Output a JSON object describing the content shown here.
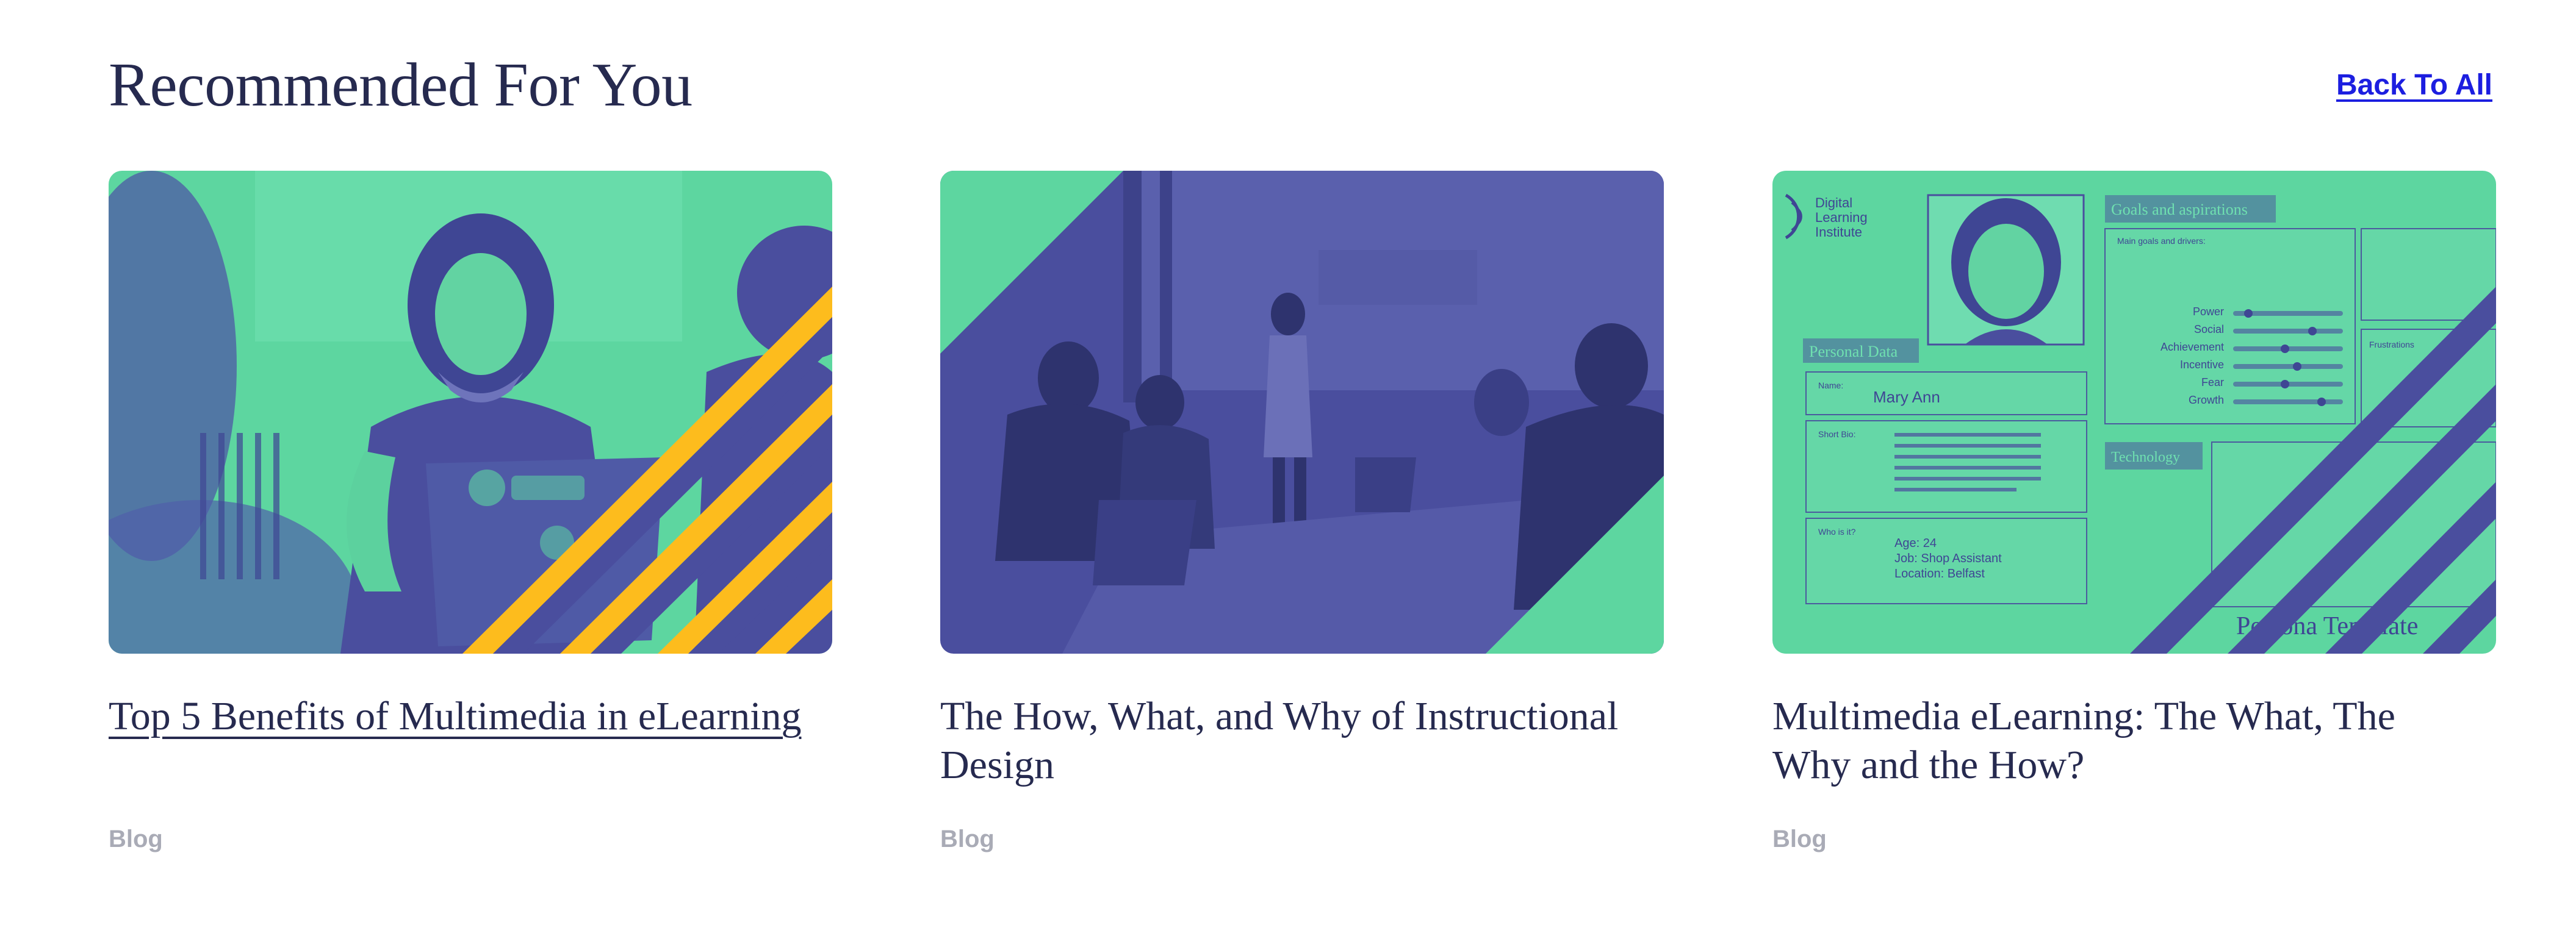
{
  "header": {
    "title": "Recommended For You",
    "back_link": "Back To All"
  },
  "colors": {
    "heading": "#262a4f",
    "link": "#1c1ee0",
    "tag": "#a9abb6",
    "brand_green": "#5dd6a0",
    "brand_indigo": "#4a4e9e",
    "brand_yellow": "#fdbc1d"
  },
  "cards": [
    {
      "title": "Top 5 Benefits of Multimedia in eLearning",
      "tag": "Blog",
      "image": "woman-with-laptop-photo"
    },
    {
      "title": "The How, What, and Why of Instructional Design",
      "tag": "Blog",
      "image": "meeting-presentation-photo"
    },
    {
      "title": "Multimedia eLearning: The What, The Why and the How?",
      "tag": "Blog",
      "image": "persona-template-photo",
      "persona": {
        "logo": "Digital Learning Institute",
        "goals_heading": "Goals and aspirations",
        "main_goals": "Main goals and drivers:",
        "personal_heading": "Personal Data",
        "name_label": "Name:",
        "name": "Mary Ann",
        "bio_label": "Short Bio:",
        "who_label": "Who is it?",
        "age": "Age: 24",
        "job": "Job: Shop Assistant",
        "location": "Location: Belfast",
        "drivers": [
          "Power",
          "Social",
          "Achievement",
          "Incentive",
          "Fear",
          "Growth"
        ],
        "technology_heading": "Technology",
        "frustrations": "Frustrations",
        "footer": "Persona Template"
      }
    }
  ]
}
